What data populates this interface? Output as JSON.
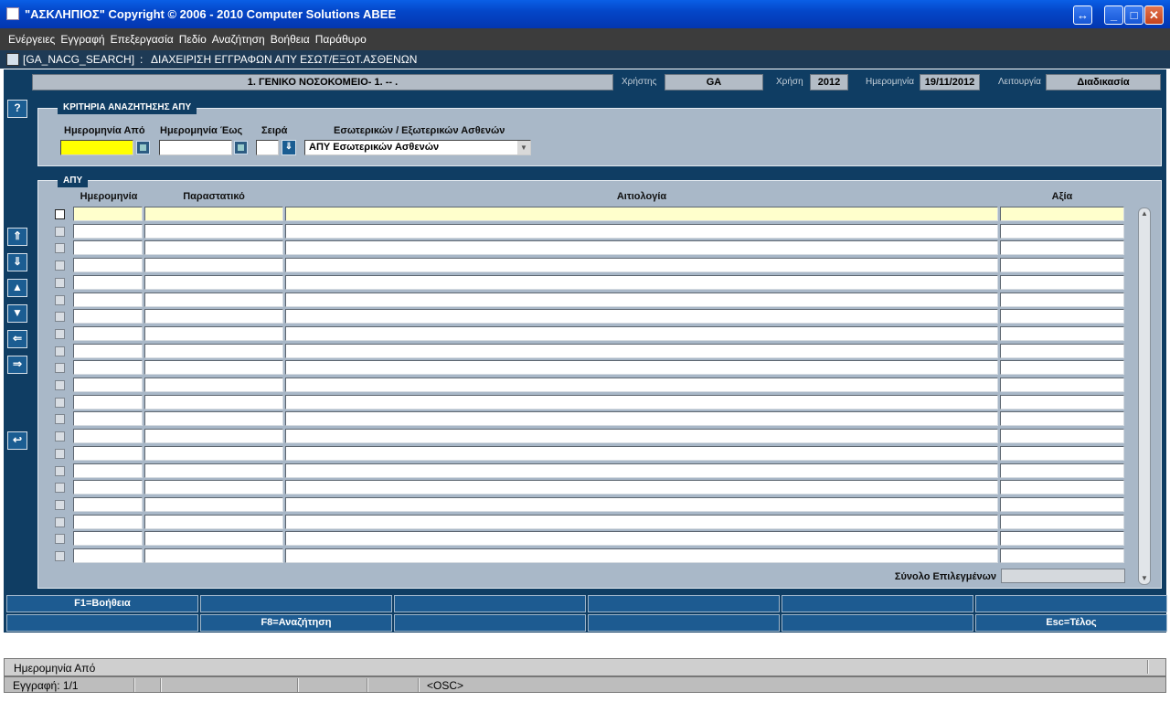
{
  "window": {
    "title": "\"ΑΣΚΛΗΠΙΟΣ\" Copyright © 2006 - 2010 Computer Solutions ABEE"
  },
  "menu": [
    "Ενέργειες",
    "Εγγραφή",
    "Επεξεργασία",
    "Πεδίο",
    "Αναζήτηση",
    "Βοήθεια",
    "Παράθυρο"
  ],
  "form": {
    "code": "[GA_NACG_SEARCH]",
    "sep": ":",
    "name": "ΔΙΑΧΕΙΡΙΣΗ ΕΓΓΡΑΦΩΝ ΑΠΥ ΕΣΩΤ/ΕΞΩΤ.ΑΣΘΕΝΩΝ"
  },
  "header": {
    "hospital": "1. ΓΕΝΙΚΟ ΝΟΣΟΚΟΜΕΙΟ- 1. -- .",
    "user_label": "Χρήστης",
    "user": "GA",
    "year_label": "Χρήση",
    "year": "2012",
    "date_label": "Ημερομηνία",
    "date": "19/11/2012",
    "function_label": "Λειτουργία",
    "function": "Διαδικασία"
  },
  "criteria": {
    "title": "ΚΡΙΤΗΡΙΑ ΑΝΑΖΗΤΗΣΗΣ ΑΠΥ",
    "date_from_label": "Ημερομηνία Από",
    "date_to_label": "Ημερομηνία Έως",
    "series_label": "Σειρά",
    "patient_type_label": "Εσωτερικών / Εξωτερικών Ασθενών",
    "patient_type_value": "ΑΠΥ Εσωτερικών Ασθενών"
  },
  "apy": {
    "title": "ΑΠΥ",
    "columns": {
      "date": "Ημερομηνία",
      "document": "Παραστατικό",
      "reason": "Αιτιολογία",
      "value": "Αξία"
    },
    "row_count": 21,
    "total_label": "Σύνολο Επιλεγμένων"
  },
  "fkeys": {
    "row1": [
      "F1=Βοήθεια",
      "",
      "",
      "",
      "",
      ""
    ],
    "row2": [
      "",
      "F8=Αναζήτηση",
      "",
      "",
      "",
      "Esc=Τέλος"
    ]
  },
  "status": {
    "hint": "Ημερομηνία Από",
    "record": "Εγγραφή: 1/1",
    "mode": "<OSC>"
  }
}
